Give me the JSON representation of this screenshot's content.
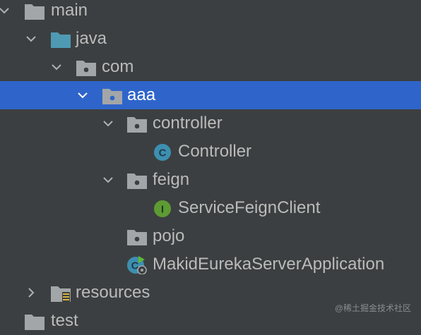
{
  "project_tree": {
    "items": [
      {
        "label": "main",
        "icon": "folder-icon",
        "expanded": true
      },
      {
        "label": "java",
        "icon": "source-folder-icon",
        "expanded": true
      },
      {
        "label": "com",
        "icon": "package-icon",
        "expanded": true
      },
      {
        "label": "aaa",
        "icon": "package-icon",
        "expanded": true,
        "selected": true
      },
      {
        "label": "controller",
        "icon": "package-icon",
        "expanded": true
      },
      {
        "label": "Controller",
        "icon": "class-icon"
      },
      {
        "label": "feign",
        "icon": "package-icon",
        "expanded": true
      },
      {
        "label": "ServiceFeignClient",
        "icon": "interface-icon"
      },
      {
        "label": "pojo",
        "icon": "package-icon"
      },
      {
        "label": "MakidEurekaServerApplication",
        "icon": "spring-boot-application-icon"
      },
      {
        "label": "resources",
        "icon": "resources-folder-icon",
        "expanded": false
      },
      {
        "label": "test",
        "icon": "folder-icon"
      }
    ]
  },
  "icon_glyphs": {
    "class": "C",
    "interface": "I"
  },
  "watermark": "@稀土掘金技术社区",
  "colors": {
    "background": "#3c3f41",
    "selection": "#2f65ca",
    "text": "#bbbbbb",
    "selected_text": "#ffffff",
    "source_folder": "#4e9ab3",
    "class_badge": "#3d8fb0",
    "interface_badge": "#5e9b34"
  }
}
